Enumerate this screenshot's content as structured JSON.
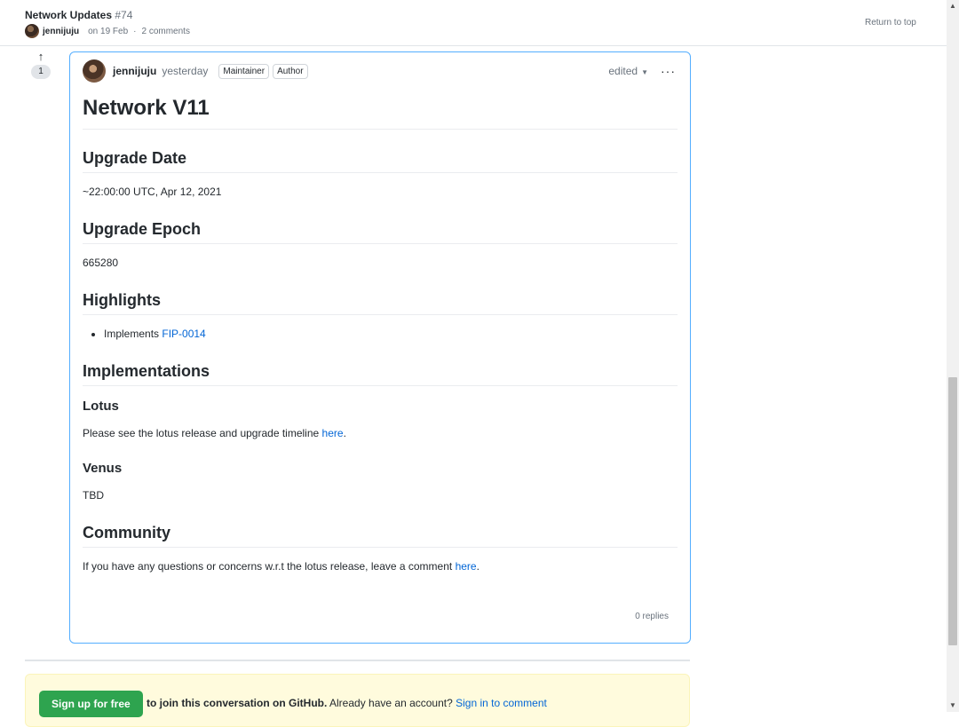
{
  "header": {
    "thread_title": "Network Updates",
    "thread_number": "#74",
    "author": "jennijuju",
    "date": "on 19 Feb",
    "separator": "·",
    "comments": "2 comments",
    "return_to_top": "Return to top"
  },
  "upvote": {
    "count": "1"
  },
  "comment": {
    "author": "jennijuju",
    "time": "yesterday",
    "badges": [
      "Maintainer",
      "Author"
    ],
    "edited": "edited",
    "replies": "0 replies",
    "body": {
      "h1": "Network V11",
      "upgrade_date_heading": "Upgrade Date",
      "upgrade_date": "~22:00:00 UTC, Apr 12, 2021",
      "upgrade_epoch_heading": "Upgrade Epoch",
      "upgrade_epoch": "665280",
      "highlights_heading": "Highlights",
      "highlight_prefix": "Implements",
      "highlight_link": "FIP-0014",
      "implementations_heading": "Implementations",
      "lotus_heading": "Lotus",
      "lotus_text": "Please see the lotus release and upgrade timeline",
      "lotus_link": "here",
      "venus_heading": "Venus",
      "venus_text": "TBD",
      "community_heading": "Community",
      "community_text": "If you have any questions or concerns w.r.t the lotus release, leave a comment",
      "community_link": "here"
    }
  },
  "signup": {
    "button": "Sign up for free",
    "text_bold": "to join this conversation on GitHub.",
    "text": "Already have an account?",
    "link": "Sign in to comment"
  },
  "colors": {
    "accent": "#0366d6",
    "active_border": "#54aeff",
    "signup_green": "#2ea44f",
    "banner_bg": "#fffbdd"
  },
  "icons": [
    "arrow-up-icon",
    "chevron-down-icon",
    "kebab-horizontal-icon"
  ]
}
